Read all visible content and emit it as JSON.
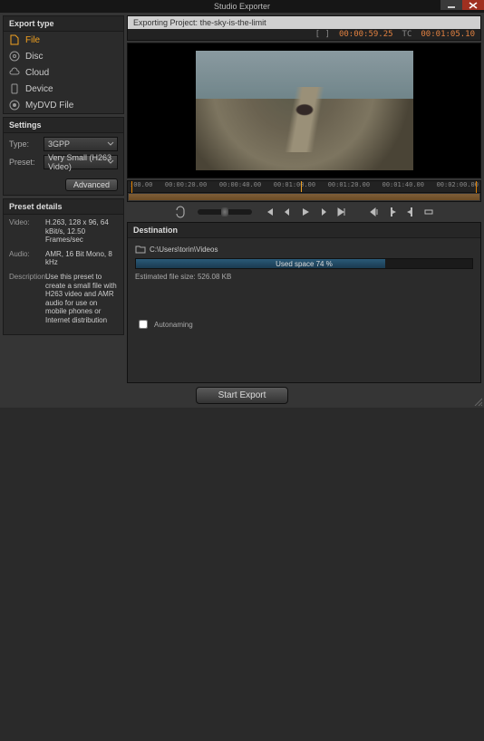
{
  "window": {
    "title": "Studio Exporter"
  },
  "export_types": {
    "header": "Export type",
    "items": [
      {
        "label": "File",
        "icon": "file-icon",
        "selected": true
      },
      {
        "label": "Disc",
        "icon": "disc-icon",
        "selected": false
      },
      {
        "label": "Cloud",
        "icon": "cloud-icon",
        "selected": false
      },
      {
        "label": "Device",
        "icon": "device-icon",
        "selected": false
      },
      {
        "label": "MyDVD File",
        "icon": "mydvd-icon",
        "selected": false
      }
    ]
  },
  "settings": {
    "header": "Settings",
    "type_label": "Type:",
    "type_value": "3GPP",
    "preset_label": "Preset:",
    "preset_value": "Very Small (H263 Video)",
    "advanced_label": "Advanced"
  },
  "preset_details": {
    "header": "Preset details",
    "video_label": "Video:",
    "video_value": "H.263, 128 x 96, 64 kBit/s, 12.50 Frames/sec",
    "audio_label": "Audio:",
    "audio_value": "AMR, 16 Bit Mono, 8 kHz",
    "desc_label": "Description:",
    "desc_value": "Use this preset to create a small file with H263 video and AMR audio for use on mobile phones or Internet distribution"
  },
  "project": {
    "header_prefix": "Exporting Project:",
    "name": "the-sky-is-the-limit",
    "tc_in_prefix": "[ ]",
    "tc_in": "00:00:59.25",
    "tc_label": "TC",
    "tc_out": "00:01:05.10"
  },
  "timeline": {
    "labels": [
      ":00.00",
      "00:00:20.00",
      "00:00:40.00",
      "00:01:00.00",
      "00:01:20.00",
      "00:01:40.00",
      "00:02:00.00"
    ]
  },
  "destination": {
    "header": "Destination",
    "path": "C:\\Users\\torin\\Videos",
    "disk_label": "Used space 74 %",
    "disk_pct": 74,
    "estimate_label": "Estimated file size:",
    "estimate_value": "526.08 KB",
    "autoname_label": "Autonaming"
  },
  "footer": {
    "start_label": "Start Export"
  }
}
